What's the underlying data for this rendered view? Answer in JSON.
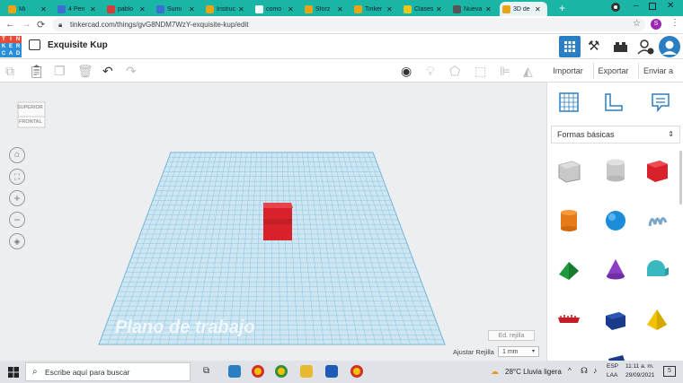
{
  "browser": {
    "tabs": [
      {
        "label": "Mi",
        "color": "#e8a317"
      },
      {
        "label": "4 Peri",
        "color": "#3b6fd6"
      },
      {
        "label": "pablo",
        "color": "#d63b3b"
      },
      {
        "label": "Sumi",
        "color": "#3b6fd6"
      },
      {
        "label": "Instruc",
        "color": "#e8a317"
      },
      {
        "label": "como",
        "color": "#ffffff"
      },
      {
        "label": "Sforz",
        "color": "#e8a317"
      },
      {
        "label": "Tinker",
        "color": "#e8a317"
      },
      {
        "label": "Clases",
        "color": "#e8c817"
      },
      {
        "label": "Nueva",
        "color": "#555555"
      },
      {
        "label": "3D de",
        "color": "#e8a317"
      }
    ],
    "url": "tinkercad.com/things/gvG8NDM7WzY-exquisite-kup/edit",
    "profile_initial": "S"
  },
  "app": {
    "logo_letters": [
      "T",
      "I",
      "N",
      "K",
      "E",
      "R",
      "C",
      "A",
      "D"
    ],
    "design_title": "Exquisite Kup",
    "import_label": "Importar",
    "export_label": "Exportar",
    "send_label": "Enviar a"
  },
  "viewcube": {
    "top": "SUPERIOR",
    "front": "FRONTAL"
  },
  "workplane": {
    "label": "Plano de trabajo",
    "edit_grid": "Ed. rejilla",
    "snap_label": "Ajustar Rejilla",
    "snap_value": "1 mm"
  },
  "panel": {
    "category": "Formas básicas",
    "collapse_glyph": "〉"
  },
  "taskbar": {
    "search_placeholder": "Escribe aquí para buscar",
    "weather": "28°C  Lluvia ligera",
    "lang_top": "ESP",
    "lang_bottom": "LAA",
    "time": "11:11 a. m.",
    "date": "29/09/2021",
    "notif_count": "5"
  }
}
